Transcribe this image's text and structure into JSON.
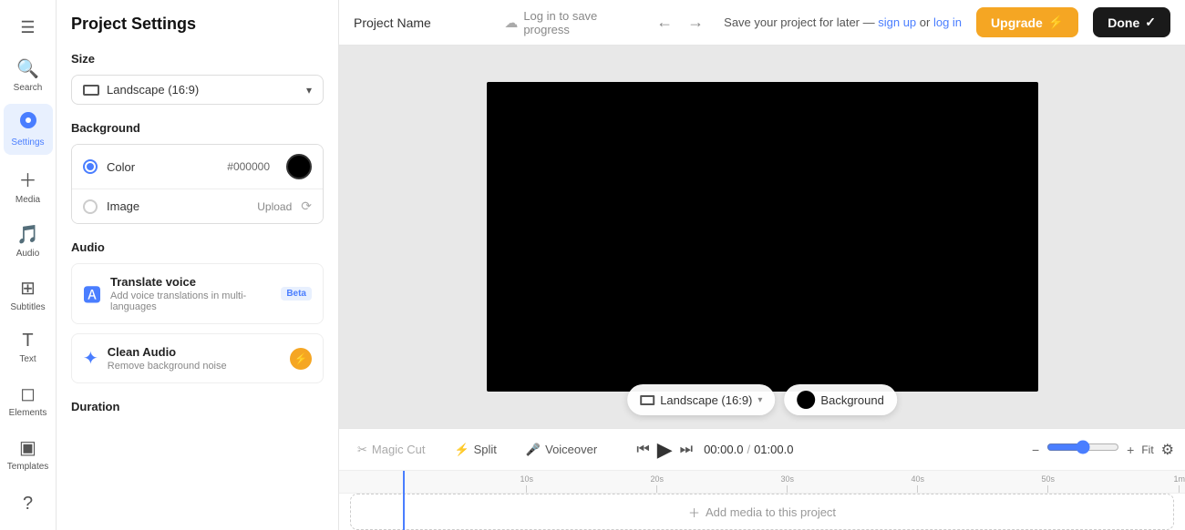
{
  "header": {
    "project_name": "Project Name",
    "save_notice": "Log in to save progress",
    "save_hint_prefix": "Save your project for later — ",
    "save_hint_signup": "sign up",
    "save_hint_or": " or ",
    "save_hint_login": "log in",
    "upgrade_label": "Upgrade",
    "done_label": "Done"
  },
  "sidebar": {
    "items": [
      {
        "label": "Search",
        "icon": "🔍",
        "id": "search"
      },
      {
        "label": "Settings",
        "icon": "⚙",
        "id": "settings",
        "active": true
      },
      {
        "label": "Media",
        "icon": "+",
        "id": "media"
      },
      {
        "label": "Audio",
        "icon": "♪",
        "id": "audio"
      },
      {
        "label": "Subtitles",
        "icon": "▦",
        "id": "subtitles"
      },
      {
        "label": "Text",
        "icon": "T",
        "id": "text"
      },
      {
        "label": "Elements",
        "icon": "◻",
        "id": "elements"
      },
      {
        "label": "Templates",
        "icon": "▣",
        "id": "templates"
      }
    ]
  },
  "settings_panel": {
    "title": "Project Settings",
    "size_section": "Size",
    "size_value": "Landscape (16:9)",
    "background_section": "Background",
    "bg_color_label": "Color",
    "bg_color_hex": "#000000",
    "bg_image_label": "Image",
    "bg_image_upload": "Upload",
    "audio_section": "Audio",
    "translate_voice_title": "Translate voice",
    "translate_voice_desc": "Add voice translations in multi-languages",
    "translate_badge": "Beta",
    "clean_audio_title": "Clean Audio",
    "clean_audio_desc": "Remove background noise",
    "duration_section": "Duration"
  },
  "preview": {
    "landscape_label": "Landscape (16:9)",
    "background_label": "Background"
  },
  "timeline": {
    "magic_cut_label": "Magic Cut",
    "split_label": "Split",
    "voiceover_label": "Voiceover",
    "current_time": "00:00.0",
    "total_time": "01:00.0",
    "fit_label": "Fit",
    "ruler_marks": [
      "10s",
      "20s",
      "30s",
      "40s",
      "50s",
      "1m"
    ],
    "add_media_label": "Add media to this project"
  }
}
